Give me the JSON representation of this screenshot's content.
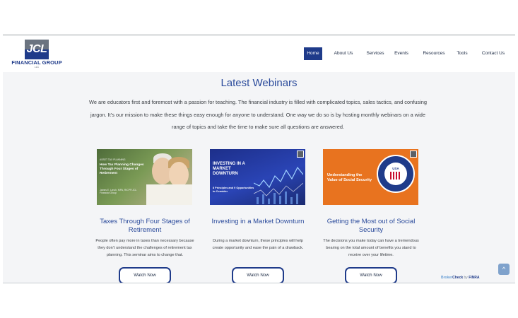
{
  "header": {
    "logo": {
      "mark_text": "JCL",
      "name": "FINANCIAL GROUP",
      "suffix": "LLC"
    },
    "nav": [
      {
        "label": "Home",
        "active": true
      },
      {
        "label": "About Us",
        "active": false
      },
      {
        "label": "Services",
        "active": false
      },
      {
        "label": "Events",
        "active": false
      },
      {
        "label": "Resources",
        "active": false
      },
      {
        "label": "Tools",
        "active": false
      },
      {
        "label": "Contact Us",
        "active": false
      }
    ]
  },
  "main": {
    "title": "Latest Webinars",
    "intro": "We are educators first and foremost with a passion for teaching. The financial industry is filled with complicated topics, sales tactics, and confusing jargon. It’s our mission to make these things easy enough for anyone to understand. One way we do so is by hosting monthly webinars on a wide range of topics and take the time to make sure all questions are answered."
  },
  "webinars": [
    {
      "image": {
        "kicker": "ASSET TAX PLANNING",
        "headline": "How Tax Planning Changes Through Four Stages of Retirement",
        "byline": "James E. Lynch, MPA, RICP® JCL Financial Group"
      },
      "title": "Taxes Through Four Stages of Retirement",
      "description": "People often pay more in taxes than necessary because they don’t understand the challenges of retirement tax planning. This seminar aims to change that.",
      "button": "Watch Now"
    },
    {
      "image": {
        "headline": "INVESTING IN A MARKET DOWNTURN",
        "sub": "8 Principles and 9 Opportunities to Consider"
      },
      "title": "Investing in a Market Downturn",
      "description": "During a market downturn, these principles will help create opportunity and ease the pain of a drawback.",
      "button": "Watch Now"
    },
    {
      "image": {
        "headline": "Understanding the Value of Social Security",
        "seal_text": "USA"
      },
      "title": "Getting the Most out of Social Security",
      "description": "The decisions you make today can have a tremendous bearing on the total amount of benefits you stand to receive over your lifetime.",
      "button": "Watch Now"
    }
  ],
  "footer_widgets": {
    "scroll_top_icon": "chevron-up-icon",
    "scroll_top_glyph": "^",
    "brokercheck": {
      "brand": "Broker",
      "check": "Check",
      "by": "by",
      "finra": "FINRA"
    }
  },
  "colors": {
    "brand_blue": "#1f3b8a",
    "title_blue": "#2a4a9b",
    "nav_active_bg": "#1f3b8a",
    "orange": "#e8731f"
  }
}
